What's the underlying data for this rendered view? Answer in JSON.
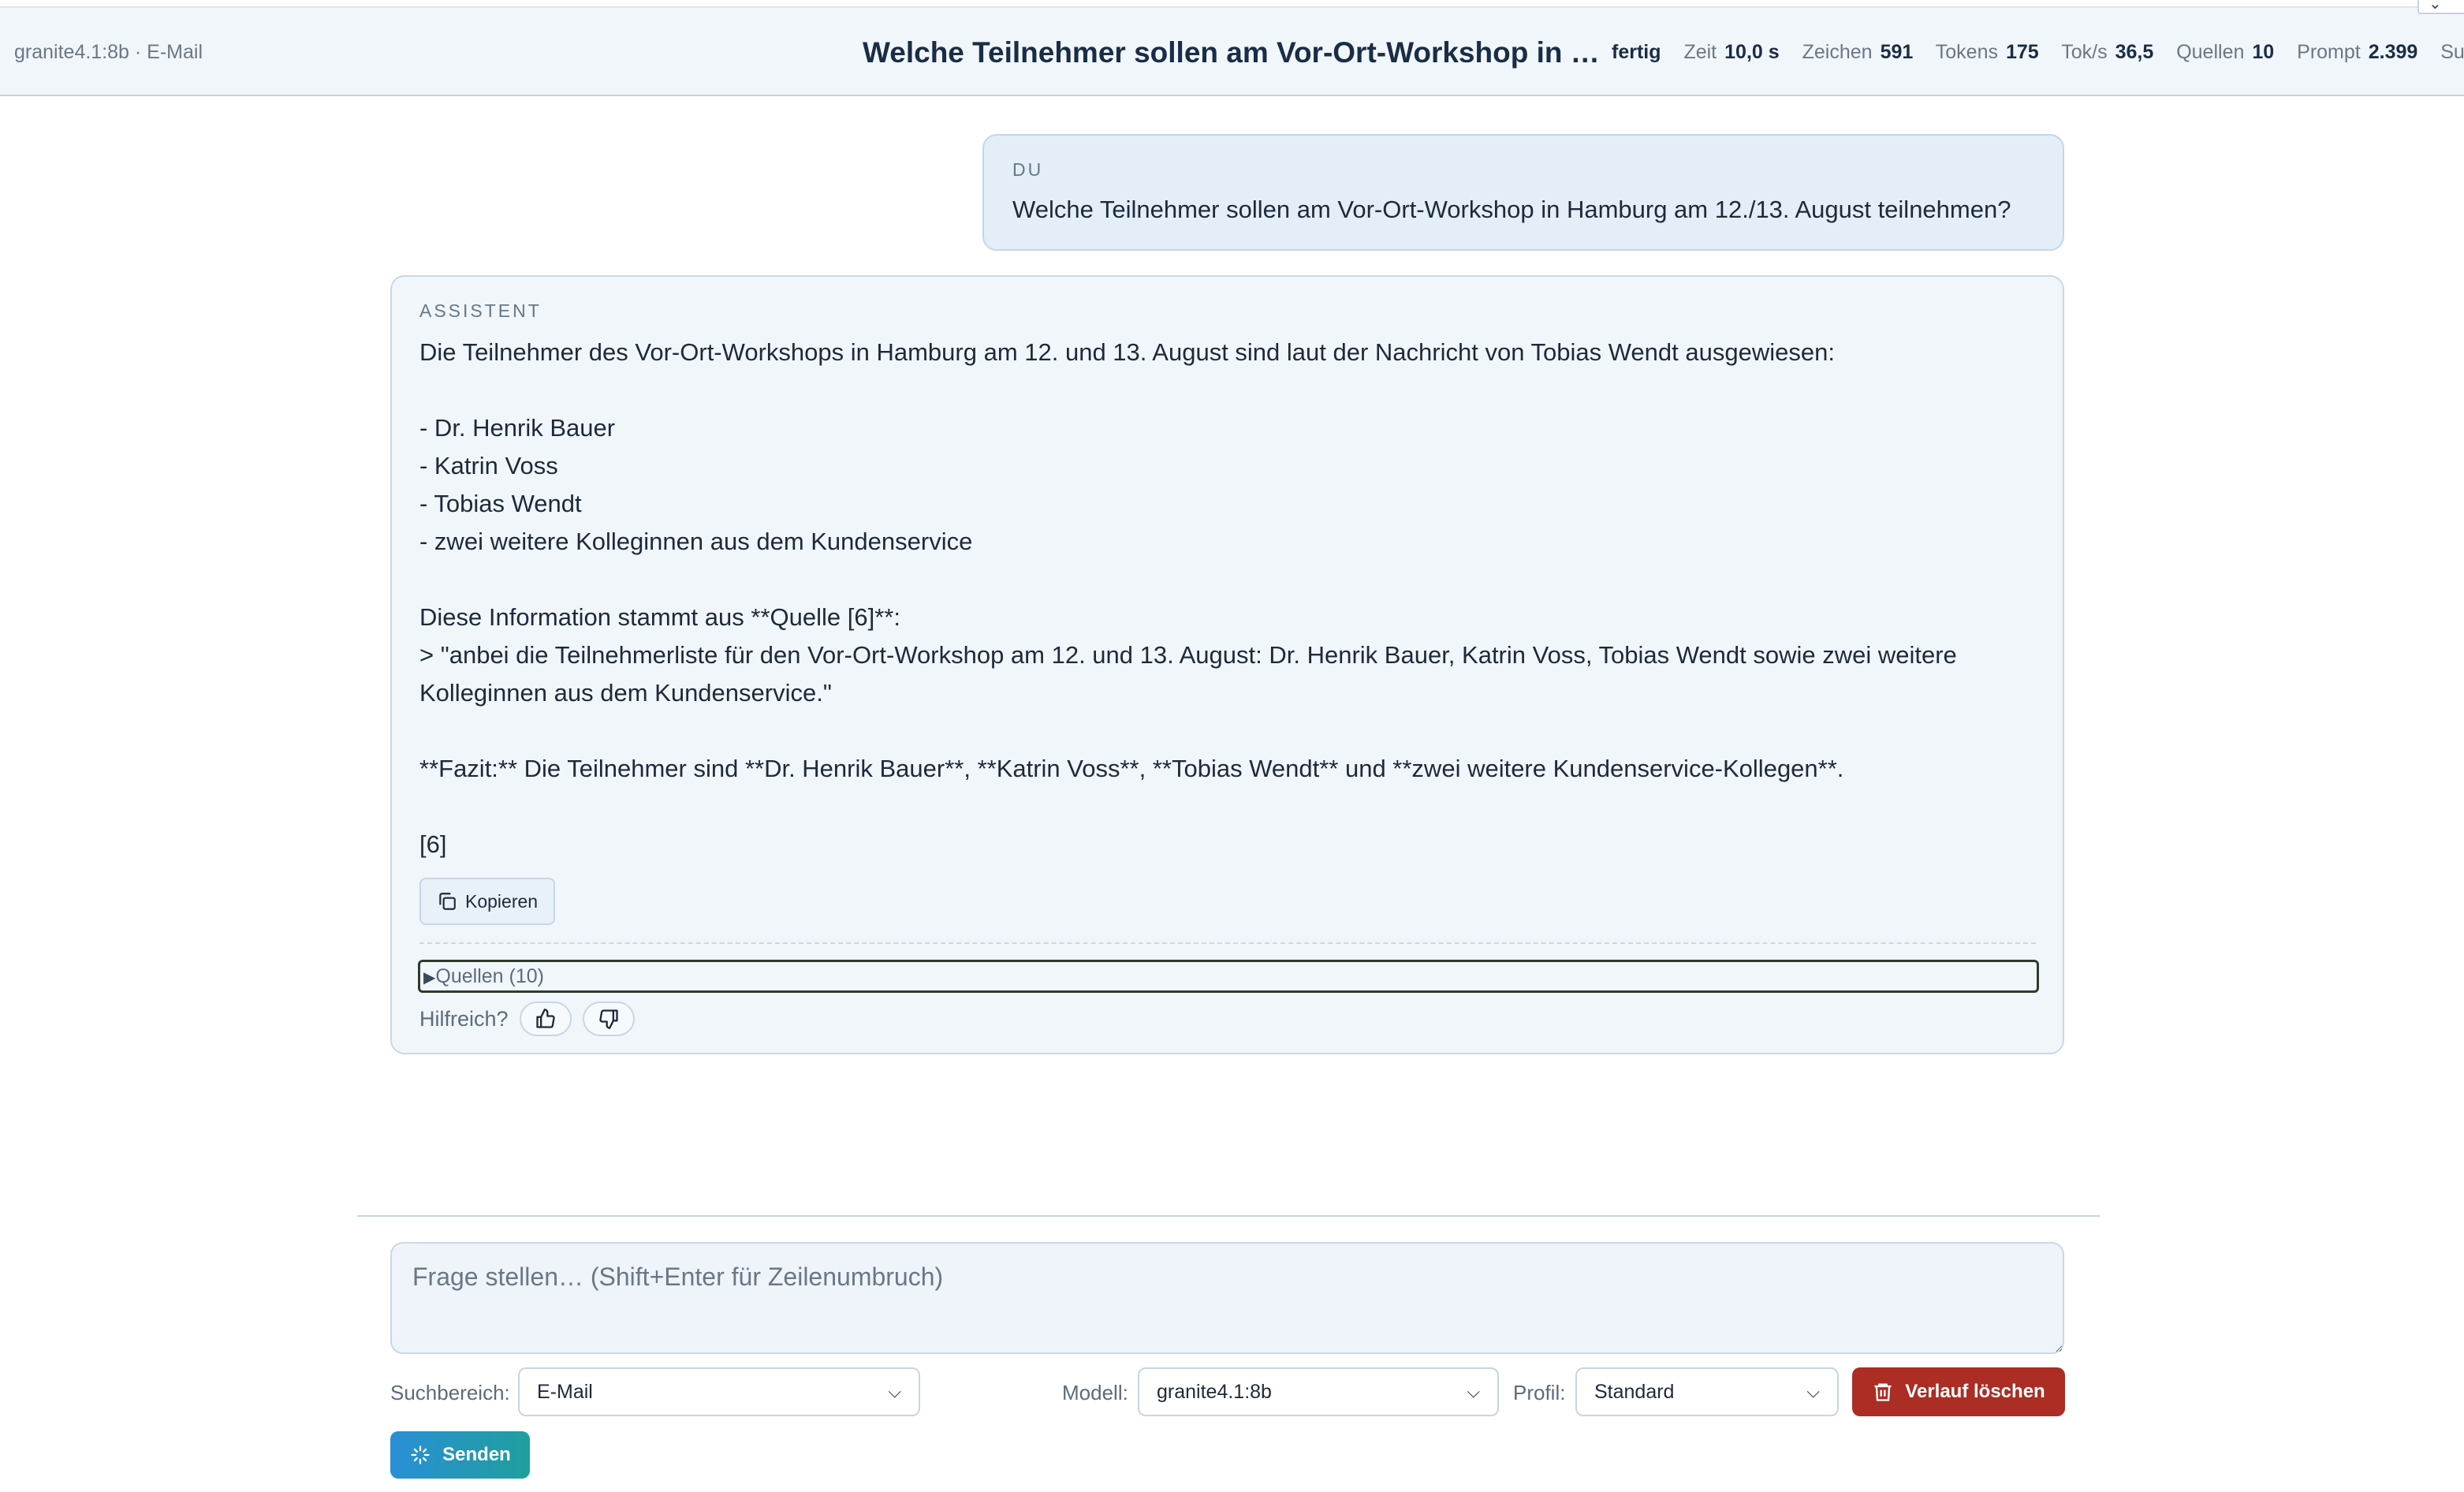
{
  "header": {
    "model_context": "granite4.1:8b · E-Mail",
    "title": "Welche Teilnehmer sollen am Vor-Ort-Workshop in …",
    "status": "fertig",
    "stats": [
      {
        "label": "Zeit",
        "value": "10,0 s"
      },
      {
        "label": "Zeichen",
        "value": "591"
      },
      {
        "label": "Tokens",
        "value": "175"
      },
      {
        "label": "Tok/s",
        "value": "36,5"
      },
      {
        "label": "Quellen",
        "value": "10"
      },
      {
        "label": "Prompt",
        "value": "2.399"
      },
      {
        "label": "Su",
        "value": ""
      }
    ]
  },
  "user_message": {
    "role": "DU",
    "text": "Welche Teilnehmer sollen am Vor-Ort-Workshop in Hamburg am 12./13. August teilnehmen?"
  },
  "assistant_message": {
    "role": "ASSISTENT",
    "text": "Die Teilnehmer des Vor-Ort-Workshops in Hamburg am 12. und 13. August sind laut der Nachricht von Tobias Wendt ausgewiesen:\n\n- Dr. Henrik Bauer\n- Katrin Voss\n- Tobias Wendt\n- zwei weitere Kolleginnen aus dem Kundenservice\n\nDiese Information stammt aus **Quelle [6]**:\n> \"anbei die Teilnehmerliste für den Vor-Ort-Workshop am 12. und 13. August: Dr. Henrik Bauer, Katrin Voss, Tobias Wendt sowie zwei weitere Kolleginnen aus dem Kundenservice.\"\n\n**Fazit:** Die Teilnehmer sind **Dr. Henrik Bauer**, **Katrin Voss**, **Tobias Wendt** und **zwei weitere Kundenservice-Kollegen**.\n\n[6]",
    "copy_label": "Kopieren",
    "sources_label": "Quellen (10)",
    "helpful_label": "Hilfreich?"
  },
  "composer": {
    "placeholder": "Frage stellen… (Shift+Enter für Zeilenumbruch)",
    "search_area_label": "Suchbereich:",
    "search_area_value": "E-Mail",
    "model_label": "Modell:",
    "model_value": "granite4.1:8b",
    "profile_label": "Profil:",
    "profile_value": "Standard",
    "clear_label": "Verlauf löschen",
    "send_label": "Senden"
  },
  "icons": {
    "copy": "copy-icon",
    "thumbs_up": "thumbs-up-icon",
    "thumbs_down": "thumbs-down-icon",
    "trash": "trash-icon",
    "sparkle": "sparkle-icon",
    "chevron": "chevron-down-icon"
  },
  "colors": {
    "danger": "#ab2d24",
    "send_start": "#2a8fd6",
    "send_end": "#1f9f9c",
    "user_bubble": "#e4eef9",
    "assistant_bubble": "#f1f6fb"
  }
}
